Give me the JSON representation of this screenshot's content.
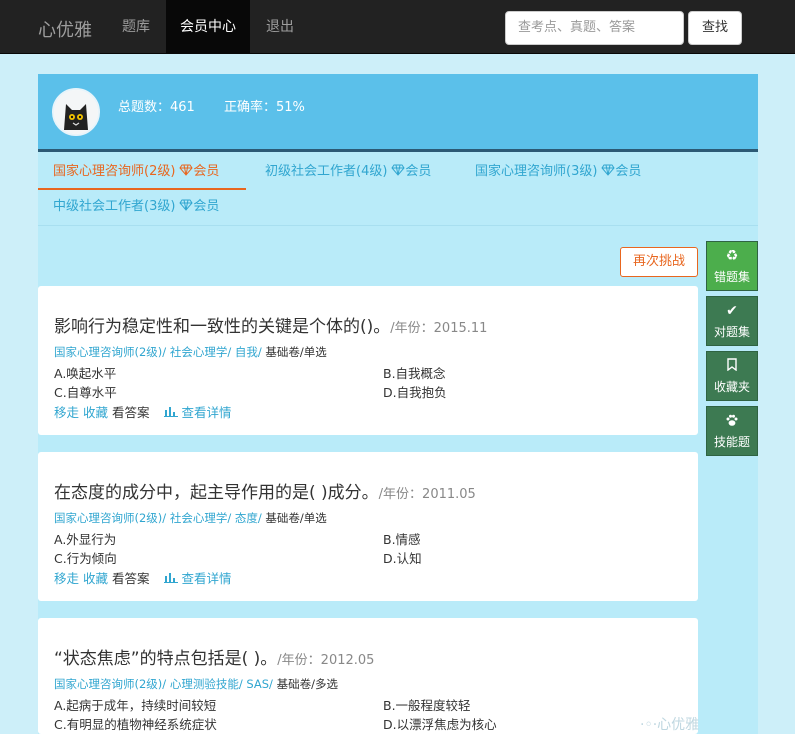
{
  "nav": {
    "brand": "心优雅",
    "links": [
      "题库",
      "会员中心",
      "退出"
    ],
    "search_placeholder": "查考点、真题、答案",
    "search_button": "查找"
  },
  "profile": {
    "total_label": "总题数：461",
    "accuracy_label": "正确率：51%"
  },
  "tabs": [
    {
      "label": "国家心理咨询师(2级)",
      "badge": "会员"
    },
    {
      "label": "初级社会工作者(4级)",
      "badge": "会员"
    },
    {
      "label": "国家心理咨询师(3级)",
      "badge": "会员"
    },
    {
      "label": "中级社会工作者(3级)",
      "badge": "会员"
    }
  ],
  "retry_button": "再次挑战",
  "side_buttons": [
    {
      "icon": "recycle-icon",
      "label": "错题集"
    },
    {
      "icon": "check-icon",
      "label": "对题集"
    },
    {
      "icon": "bookmark-icon",
      "label": "收藏夹"
    },
    {
      "icon": "paw-icon",
      "label": "技能题"
    }
  ],
  "questions": [
    {
      "title": "影响行为稳定性和一致性的关键是个体的()。",
      "year": "/年份：2015.11",
      "tag1": "国家心理咨询师(2级)/",
      "tag2": " 社会心理学/",
      "tag3": " 自我/",
      "tag4": " 基础卷/单选",
      "options": [
        "A.唤起水平",
        "B.自我概念",
        "C.自尊水平",
        "D.自我抱负"
      ],
      "action_move": "移走",
      "action_fav": "收藏",
      "action_answer": "看答案",
      "action_detail": "查看详情"
    },
    {
      "title": "在态度的成分中，起主导作用的是( )成分。",
      "year": "/年份：2011.05",
      "tag1": "国家心理咨询师(2级)/",
      "tag2": " 社会心理学/",
      "tag3": " 态度/",
      "tag4": " 基础卷/单选",
      "options": [
        "A.外显行为",
        "B.情感",
        "C.行为倾向",
        "D.认知"
      ],
      "action_move": "移走",
      "action_fav": "收藏",
      "action_answer": "看答案",
      "action_detail": "查看详情"
    },
    {
      "title": "“状态焦虑”的特点包括是( )。",
      "year": "/年份：2012.05",
      "tag1": "国家心理咨询师(2级)/",
      "tag2": " 心理测验技能/",
      "tag3": " SAS/",
      "tag4": " 基础卷/多选",
      "options": [
        "A.起病于成年，持续时间较短",
        "B.一般程度较轻",
        "C.有明显的植物神经系统症状",
        "D.以漂浮焦虑为核心"
      ]
    }
  ],
  "watermark": "·◦·心优雅"
}
